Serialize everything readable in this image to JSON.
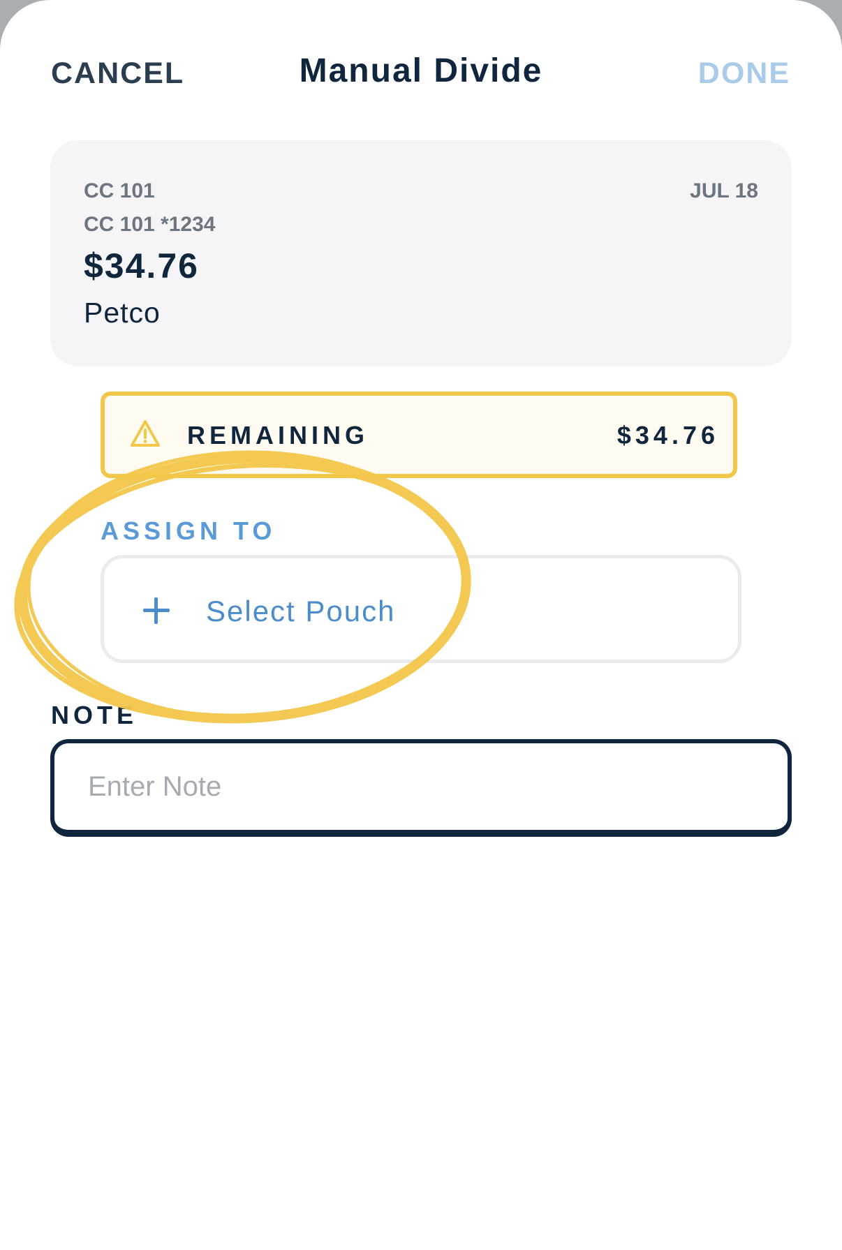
{
  "header": {
    "cancel_label": "CANCEL",
    "title": "Manual Divide",
    "done_label": "DONE"
  },
  "transaction": {
    "account_name": "CC 101",
    "account_number": "CC 101 *1234",
    "date": "JUL 18",
    "amount": "$34.76",
    "merchant": "Petco"
  },
  "remaining": {
    "icon": "warning-icon",
    "label": "REMAINING",
    "amount": "$34.76"
  },
  "assign": {
    "label": "ASSIGN TO",
    "icon": "plus-icon",
    "select_label": "Select Pouch"
  },
  "note": {
    "label": "NOTE",
    "placeholder": "Enter Note",
    "value": ""
  },
  "colors": {
    "primary_text": "#10263d",
    "accent_blue": "#4a8ccc",
    "done_disabled": "#a9cbea",
    "warning_yellow": "#f3c74a",
    "card_background": "#f5f5f7"
  }
}
